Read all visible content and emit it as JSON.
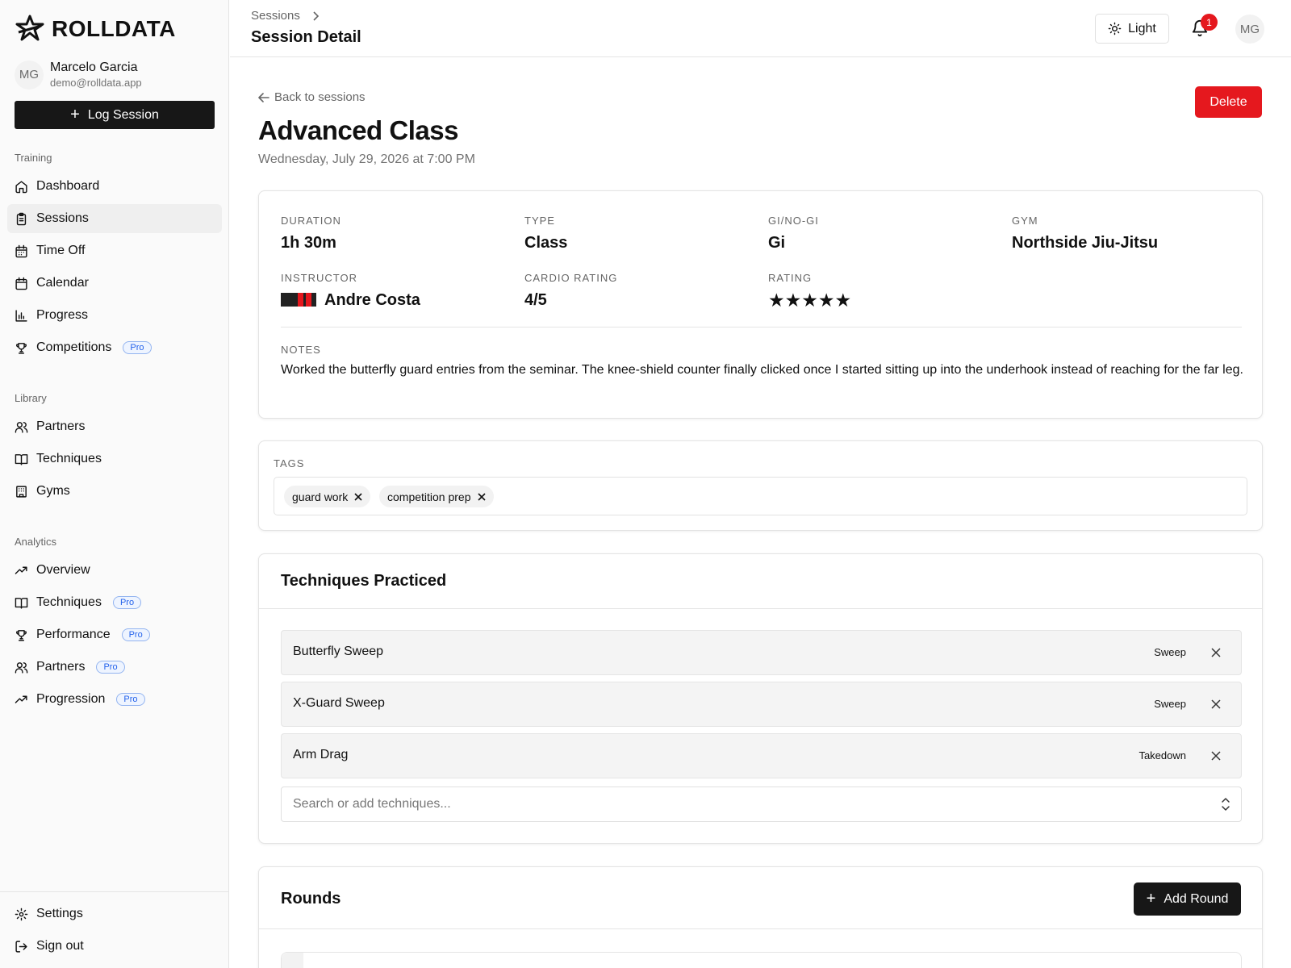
{
  "brand": {
    "name": "ROLLDATA"
  },
  "user": {
    "initials": "MG",
    "name": "Marcelo Garcia",
    "email": "demo@rolldata.app"
  },
  "sidebar": {
    "log_session_label": "Log Session",
    "sections": {
      "training": "Training",
      "library": "Library",
      "analytics": "Analytics"
    },
    "training_items": [
      {
        "label": "Dashboard",
        "icon": "home-icon"
      },
      {
        "label": "Sessions",
        "icon": "clipboard-icon",
        "active": true
      },
      {
        "label": "Time Off",
        "icon": "calendar-off-icon"
      },
      {
        "label": "Calendar",
        "icon": "calendar-icon"
      },
      {
        "label": "Progress",
        "icon": "bar-chart-icon"
      },
      {
        "label": "Competitions",
        "icon": "trophy-icon",
        "badge": "Pro"
      }
    ],
    "library_items": [
      {
        "label": "Partners",
        "icon": "users-icon"
      },
      {
        "label": "Techniques",
        "icon": "book-open-icon"
      },
      {
        "label": "Gyms",
        "icon": "building-icon"
      }
    ],
    "analytics_items": [
      {
        "label": "Overview",
        "icon": "trending-up-icon"
      },
      {
        "label": "Techniques",
        "icon": "book-open-icon",
        "badge": "Pro"
      },
      {
        "label": "Performance",
        "icon": "trophy-icon",
        "badge": "Pro"
      },
      {
        "label": "Partners",
        "icon": "users-icon",
        "badge": "Pro"
      },
      {
        "label": "Progression",
        "icon": "trending-up-icon",
        "badge": "Pro"
      }
    ],
    "footer_items": [
      {
        "label": "Settings",
        "icon": "gear-icon"
      },
      {
        "label": "Sign out",
        "icon": "sign-out-icon"
      }
    ]
  },
  "header": {
    "breadcrumb": "Sessions",
    "title": "Session Detail",
    "theme_label": "Light",
    "notification_count": "1",
    "avatar_initials": "MG"
  },
  "session": {
    "back_label": "Back to sessions",
    "delete_label": "Delete",
    "title": "Advanced Class",
    "datetime": "Wednesday, July 29, 2026 at 7:00 PM",
    "stats": {
      "duration_label": "DURATION",
      "duration": "1h 30m",
      "type_label": "TYPE",
      "type": "Class",
      "gi_label": "GI/NO-GI",
      "gi": "Gi",
      "gym_label": "GYM",
      "gym": "Northside Jiu-Jitsu",
      "instructor_label": "INSTRUCTOR",
      "instructor": "Andre Costa",
      "cardio_label": "CARDIO RATING",
      "cardio": "4/5",
      "rating_label": "RATING",
      "rating": 5,
      "rating_max": 5
    },
    "notes_label": "NOTES",
    "notes": "Worked the butterfly guard entries from the seminar. The knee-shield counter finally clicked once I started sitting up into the underhook instead of reaching for the far leg.",
    "belt_colors": {
      "belt": "#222222",
      "stripe": "#e5181e"
    }
  },
  "tags": {
    "label": "TAGS",
    "items": [
      "guard work",
      "competition prep"
    ]
  },
  "techniques": {
    "title": "Techniques Practiced",
    "items": [
      {
        "name": "Butterfly Sweep",
        "category": "Sweep"
      },
      {
        "name": "X-Guard Sweep",
        "category": "Sweep"
      },
      {
        "name": "Arm Drag",
        "category": "Takedown"
      }
    ],
    "search_placeholder": "Search or add techniques..."
  },
  "rounds": {
    "title": "Rounds",
    "add_label": "Add Round"
  },
  "colors": {
    "accent_red": "#e5181e",
    "primary_dark": "#171717",
    "pro_badge": "#2563eb"
  }
}
